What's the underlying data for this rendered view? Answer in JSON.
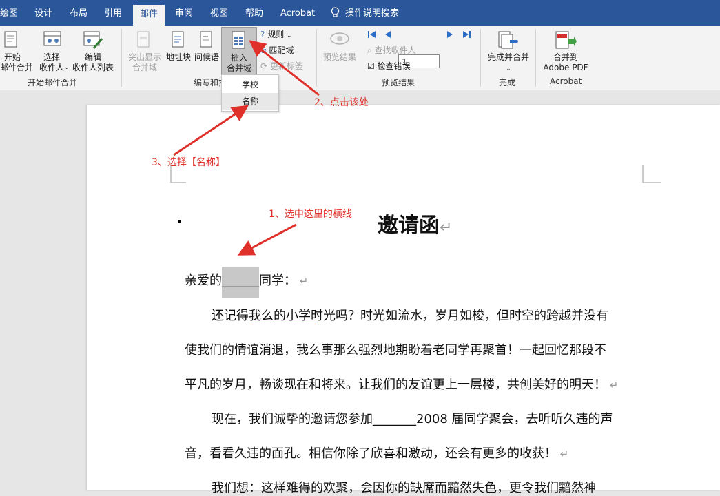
{
  "tabs": [
    "绘图",
    "设计",
    "布局",
    "引用",
    "邮件",
    "审阅",
    "视图",
    "帮助",
    "Acrobat"
  ],
  "active_tab": "邮件",
  "tell_me": "操作说明搜索",
  "ribbon": {
    "start_merge": "开始\n邮件合并",
    "select_recipients": "选择\n收件人",
    "edit_recipients": "编辑\n收件人列表",
    "group_start": "开始邮件合并",
    "highlight_fields": "突出显示\n合并域",
    "address_block": "地址块",
    "greeting_line": "问候语",
    "insert_merge_field": "插入\n合并域",
    "rules": "规则",
    "match_fields": "匹配域",
    "update_labels": "更新标签",
    "group_write": "编写和插",
    "preview_results": "预览结果",
    "find_recipient": "查找收件人",
    "check_errors": "检查错误",
    "record_number": "1",
    "group_preview": "预览结果",
    "finish_merge": "完成并合并",
    "group_finish": "完成",
    "merge_pdf": "合并到\nAdobe PDF",
    "group_acrobat": "Acrobat"
  },
  "dropdown": [
    "学校",
    "名称"
  ],
  "annotations": {
    "step1": "1、选中这里的横线",
    "step2": "2、点击该处",
    "step3": "3、选择【名称】"
  },
  "document": {
    "title": "邀请函",
    "salutation_pre": "亲爱的",
    "blank": "______",
    "salutation_post": "同学：",
    "p1_l1": "还记得我么的小学时光吗？时光如流水，岁月如梭，但时空的跨越并没有",
    "p1_l2": "使我们的情谊消退，我么事那么强烈地期盼着老同学再聚首！一起回忆那段不",
    "p1_l3": "平凡的岁月，畅谈现在和将来。让我们的友谊更上一层楼，共创美好的明天！",
    "p2_l1": "现在，我们诚挚的邀请您参加_______2008 届同学聚会，去听听久违的声",
    "p2_l2": "音，看看久违的面孔。相信你除了欣喜和激动，还会有更多的收获！",
    "p3_l1": "我们想：这样难得的欢聚，会因你的缺席而黯然失色，更令我们黯然神"
  },
  "colors": {
    "tab_bar": "#2b579a",
    "annotation": "#e0302a",
    "selection": "#c8c8c8"
  }
}
